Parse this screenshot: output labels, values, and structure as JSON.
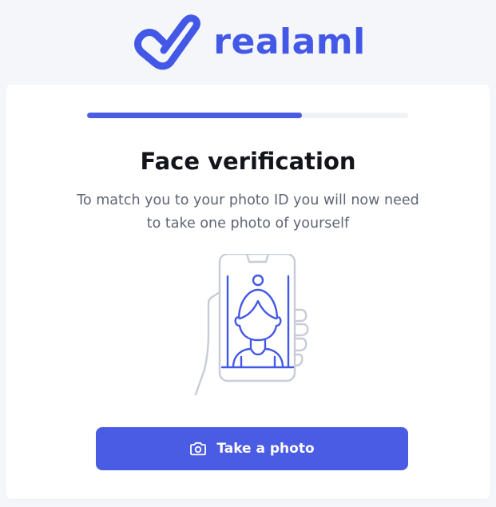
{
  "brand": {
    "name": "realaml",
    "logo_icon": "check-heart-logo-icon",
    "color": "#4358E6"
  },
  "progress": {
    "value_fraction": 0.67,
    "fill_color": "#4A5BE4",
    "track_color": "#F1F2F5"
  },
  "verification": {
    "title": "Face verification",
    "description": "To match you to your photo ID you will now need to take one photo of yourself",
    "illustration_icon": "phone-selfie-illustration-icon"
  },
  "actions": {
    "take_photo_label": "Take a photo",
    "take_photo_icon": "camera-icon",
    "button_color": "#4A5BE4"
  }
}
